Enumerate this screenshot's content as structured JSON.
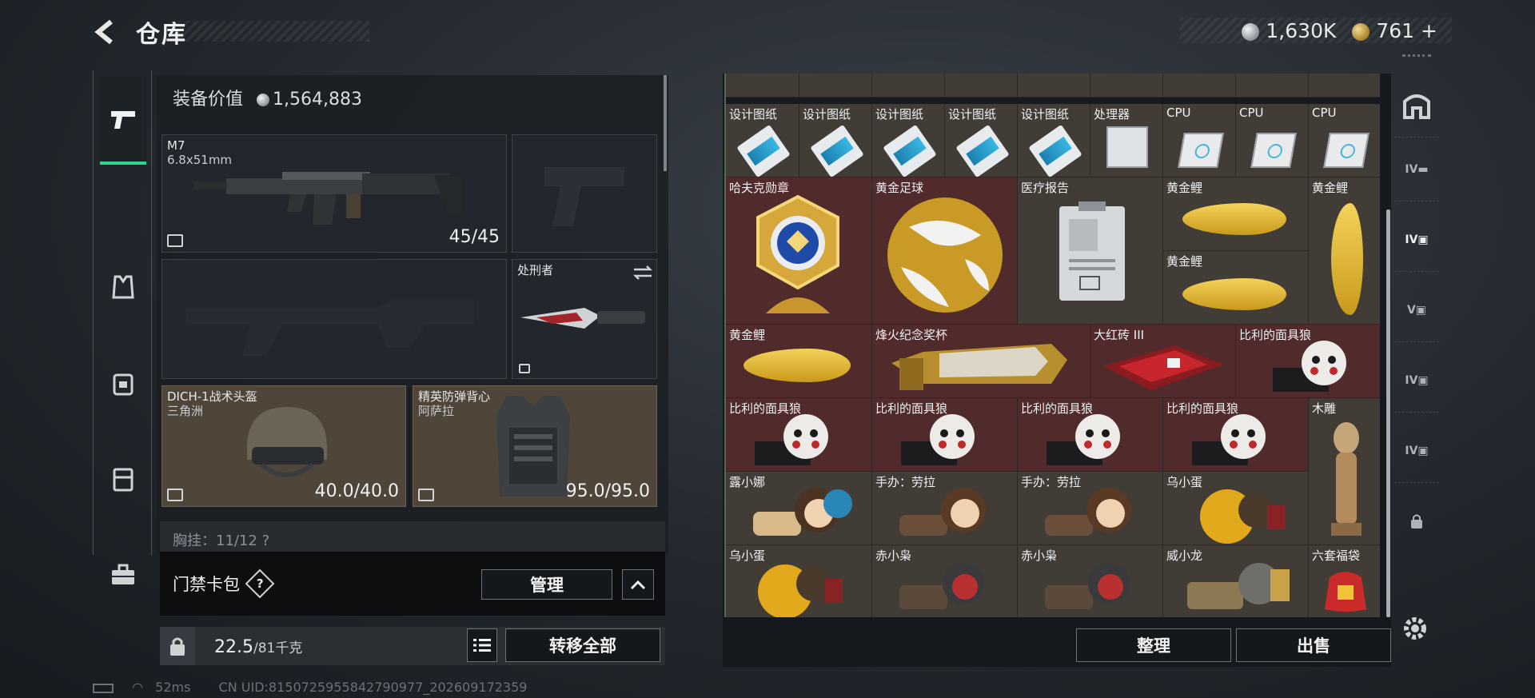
{
  "header": {
    "title": "仓库",
    "silver_amount": "1,630K",
    "gold_amount": "761 +"
  },
  "loadout": {
    "equip_value_label": "装备价值",
    "equip_value": "1,564,883",
    "primary": {
      "name": "M7",
      "caliber": "6.8x51mm",
      "ammo": "45/45"
    },
    "melee": {
      "name": "处刑者"
    },
    "helmet": {
      "name": "DICH-1战术头盔",
      "origin": "三角洲",
      "durability": "40.0/40.0"
    },
    "armor": {
      "name": "精英防弹背心",
      "origin": "阿萨拉",
      "durability": "95.0/95.0"
    },
    "chest_rig": "胸挂：11/12 ?",
    "keycard_label": "门禁卡包",
    "keycard_help": "?",
    "manage_label": "管理",
    "weight": "22.5",
    "weight_max": "/81千克",
    "transfer_all_label": "转移全部"
  },
  "warehouse": {
    "row1": [
      "设计图纸",
      "设计图纸",
      "设计图纸",
      "设计图纸",
      "设计图纸",
      "处理器",
      "CPU",
      "CPU",
      "CPU"
    ],
    "items": {
      "medal": "哈夫克勋章",
      "golden_ball": "黄金足球",
      "medical_report": "医疗报告",
      "koi_1": "黄金鲤",
      "koi_2": "黄金鲤",
      "koi_3": "黄金鲤",
      "koi_4": "黄金鲤",
      "trophy": "烽火纪念奖杯",
      "brick": "大红砖 III",
      "billy_1": "比利的面具狼",
      "billy_2": "比利的面具狼",
      "billy_3": "比利的面具狼",
      "billy_4": "比利的面具狼",
      "billy_5": "比利的面具狼",
      "carving": "木雕",
      "lunuo": "露小娜",
      "figure_1": "手办：劳拉",
      "figure_2": "手办：劳拉",
      "wu_1": "乌小蛋",
      "wu_2": "乌小蛋",
      "chi_1": "赤小枭",
      "chi_2": "赤小枭",
      "wei": "威小龙",
      "lucky_bag": "六套福袋"
    },
    "sort_label": "整理",
    "sell_label": "出售"
  },
  "status": {
    "ping": "52ms",
    "uid": "CN UID:8150725955842790977_202609172359"
  },
  "colors": {
    "accent_green": "#2fd48a",
    "cell_brown": "#413d36",
    "cell_red": "#512a2c"
  },
  "icons": [
    "back-arrow-icon",
    "silver-coin-icon",
    "gold-coin-icon",
    "pistol-icon",
    "vest-icon",
    "backpack-icon",
    "rig-icon",
    "toolbox-icon",
    "lock-icon",
    "list-icon",
    "chevron-up-icon",
    "gear-icon"
  ]
}
